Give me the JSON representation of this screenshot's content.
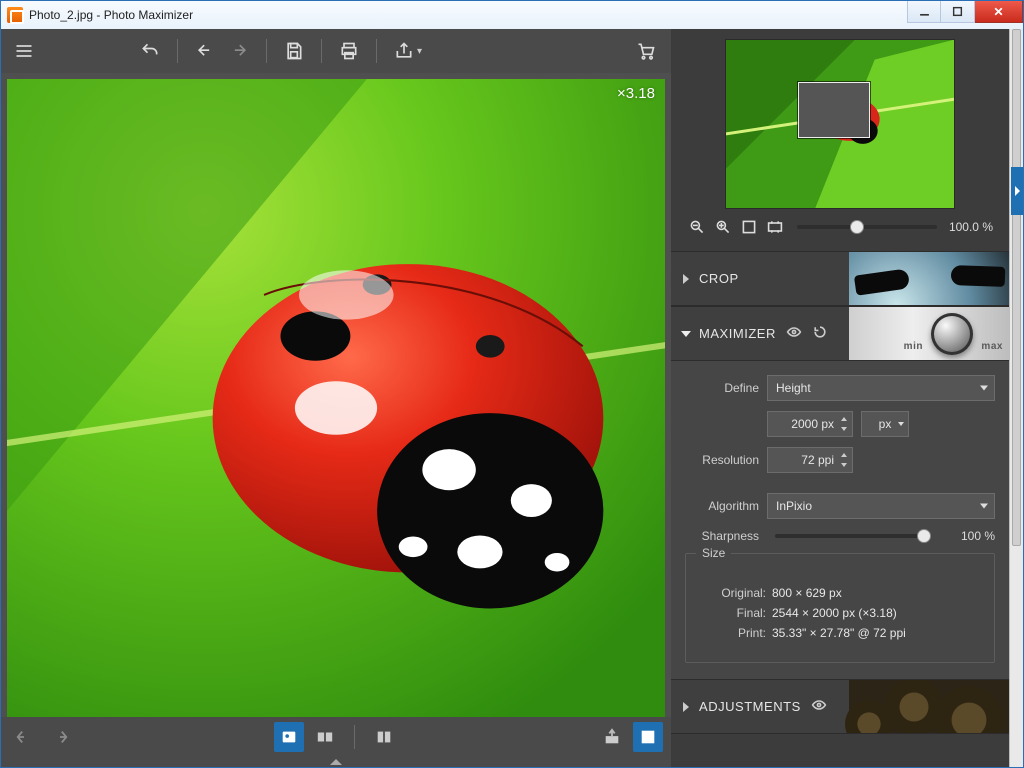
{
  "window": {
    "title": "Photo_2.jpg - Photo Maximizer"
  },
  "canvas": {
    "zoom_label": "×3.18"
  },
  "navigator": {
    "zoom_pct": "100.0 %"
  },
  "panels": {
    "crop": {
      "title": "CROP"
    },
    "maximizer": {
      "title": "MAXIMIZER",
      "knob_min": "min",
      "knob_max": "max",
      "define_label": "Define",
      "define_value": "Height",
      "size_value": "2000 px",
      "size_unit": "px",
      "resolution_label": "Resolution",
      "resolution_value": "72 ppi",
      "algorithm_label": "Algorithm",
      "algorithm_value": "InPixio",
      "sharpness_label": "Sharpness",
      "sharpness_value": "100 %",
      "size_group": {
        "legend": "Size",
        "original_label": "Original:",
        "original_value": "800 × 629 px",
        "final_label": "Final:",
        "final_value": "2544 × 2000 px (×3.18)",
        "print_label": "Print:",
        "print_value": "35.33\" × 27.78\" @ 72 ppi"
      }
    },
    "adjustments": {
      "title": "ADJUSTMENTS"
    }
  }
}
